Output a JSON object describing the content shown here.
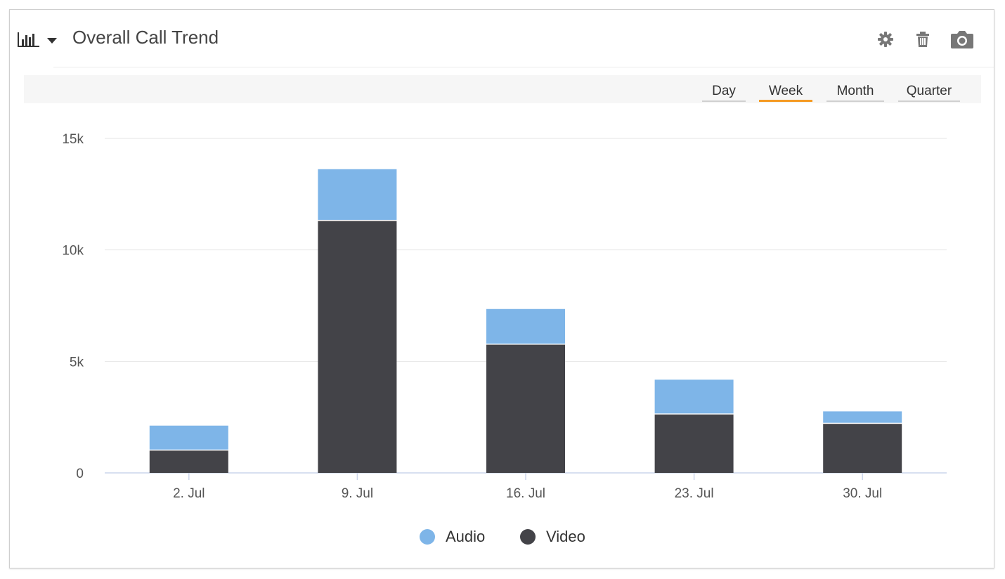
{
  "header": {
    "title": "Overall Call Trend",
    "icons": [
      "bar-chart-icon",
      "chevron-down-icon",
      "gear-icon",
      "trash-icon",
      "camera-icon"
    ]
  },
  "range_selector": {
    "options": [
      "Day",
      "Week",
      "Month",
      "Quarter"
    ],
    "selected": "Week"
  },
  "colors": {
    "audio": "#7eb5e8",
    "video": "#434348",
    "active_tab": "#f59a23",
    "grid": "#e6e6e6"
  },
  "legend": {
    "items": [
      {
        "name": "Audio"
      },
      {
        "name": "Video"
      }
    ]
  },
  "chart_data": {
    "type": "bar",
    "stacked": true,
    "categories": [
      "2. Jul",
      "9. Jul",
      "16. Jul",
      "23. Jul",
      "30. Jul"
    ],
    "series": [
      {
        "name": "Video",
        "values": [
          1000,
          11300,
          5750,
          2620,
          2200
        ]
      },
      {
        "name": "Audio",
        "values": [
          1120,
          2320,
          1600,
          1560,
          560
        ]
      }
    ],
    "yticks": [
      "0",
      "5k",
      "10k",
      "15k"
    ],
    "ylim": [
      0,
      15000
    ],
    "grid": true,
    "legend_position": "bottom-center"
  }
}
